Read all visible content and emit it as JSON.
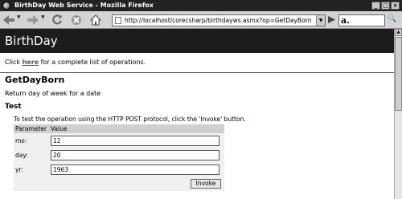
{
  "window": {
    "title": "BirthDay Web Service - Mozilla Firefox",
    "buttons": {
      "minimize": "_",
      "maximize": "□",
      "close": "×"
    }
  },
  "toolbar": {
    "url": "http://localhost/corecsharp/birthdayws.asmx?op=GetDayBorn",
    "search_engine_icon": "a."
  },
  "page": {
    "heading": "BirthDay",
    "intro_before": "Click",
    "intro_link": "here",
    "intro_after": "for a complete list of operations.",
    "operation_title": "GetDayBorn",
    "operation_description": "Return day of week for a date",
    "test_heading": "Test",
    "test_description": "To test the operation using the HTTP POST protocol, click the 'Invoke' button.",
    "table": {
      "headers": [
        "Parameter",
        "Value"
      ],
      "rows": [
        {
          "label": "mo:",
          "value": "12"
        },
        {
          "label": "day:",
          "value": "20"
        },
        {
          "label": "yr:",
          "value": "1963"
        }
      ]
    },
    "invoke_label": "Invoke"
  }
}
